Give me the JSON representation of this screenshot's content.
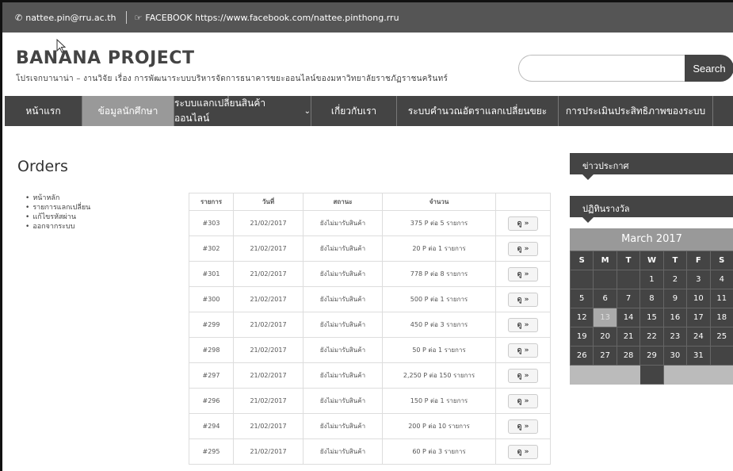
{
  "topbar": {
    "email": "nattee.pin@rru.ac.th",
    "facebook": "FACEBOOK https://www.facebook.com/nattee.pinthong.rru"
  },
  "brand": {
    "title": "BANANA PROJECT",
    "subtitle": "โปรเจกบานาน่า – งานวิจัย เรื่อง การพัฒนาระบบบริหารจัดการธนาคารขยะออนไลน์ของมหาวิทยาลัยราชภัฏราชนครินทร์"
  },
  "search": {
    "placeholder": "",
    "button": "Search"
  },
  "nav": {
    "items": [
      "หน้าแรก",
      "ข้อมูลนักศึกษา",
      "ระบบแลกเปลี่ยนสินค้าออนไลน์",
      "เกี่ยวกับเรา",
      "ระบบคำนวณอัตราแลกเปลี่ยนขยะ",
      "การประเมินประสิทธิภาพของระบบ"
    ]
  },
  "page": {
    "heading": "Orders"
  },
  "menu": [
    "หน้าหลัก",
    "รายการแลกเปลี่ยน",
    "แก้ไขรหัสผ่าน",
    "ออกจากระบบ"
  ],
  "orders": {
    "headers": [
      "รายการ",
      "วันที่",
      "สถานะ",
      "จำนวน",
      ""
    ],
    "view_label": "ดู »",
    "rows": [
      {
        "id": "#303",
        "date": "21/02/2017",
        "status": "ยังไม่มารับสินค้า",
        "amount": "375 P ต่อ 5 รายการ"
      },
      {
        "id": "#302",
        "date": "21/02/2017",
        "status": "ยังไม่มารับสินค้า",
        "amount": "20 P ต่อ 1 รายการ"
      },
      {
        "id": "#301",
        "date": "21/02/2017",
        "status": "ยังไม่มารับสินค้า",
        "amount": "778 P ต่อ 8 รายการ"
      },
      {
        "id": "#300",
        "date": "21/02/2017",
        "status": "ยังไม่มารับสินค้า",
        "amount": "500 P ต่อ 1 รายการ"
      },
      {
        "id": "#299",
        "date": "21/02/2017",
        "status": "ยังไม่มารับสินค้า",
        "amount": "450 P ต่อ 3 รายการ"
      },
      {
        "id": "#298",
        "date": "21/02/2017",
        "status": "ยังไม่มารับสินค้า",
        "amount": "50 P ต่อ 1 รายการ"
      },
      {
        "id": "#297",
        "date": "21/02/2017",
        "status": "ยังไม่มารับสินค้า",
        "amount": "2,250 P ต่อ 150 รายการ"
      },
      {
        "id": "#296",
        "date": "21/02/2017",
        "status": "ยังไม่มารับสินค้า",
        "amount": "150 P ต่อ 1 รายการ"
      },
      {
        "id": "#294",
        "date": "21/02/2017",
        "status": "ยังไม่มารับสินค้า",
        "amount": "200 P ต่อ 10 รายการ"
      },
      {
        "id": "#295",
        "date": "21/02/2017",
        "status": "ยังไม่มารับสินค้า",
        "amount": "60 P ต่อ 3 รายการ"
      }
    ]
  },
  "sidebar": {
    "news": "ข่าวประกาศ",
    "calendar_title": "ปฏิทินรางวัล"
  },
  "calendar": {
    "month": "March 2017",
    "weekdays": [
      "S",
      "M",
      "T",
      "W",
      "T",
      "F",
      "S"
    ],
    "weeks": [
      [
        "",
        "",
        "",
        "1",
        "2",
        "3",
        "4"
      ],
      [
        "5",
        "6",
        "7",
        "8",
        "9",
        "10",
        "11"
      ],
      [
        "12",
        "13",
        "14",
        "15",
        "16",
        "17",
        "18"
      ],
      [
        "19",
        "20",
        "21",
        "22",
        "23",
        "24",
        "25"
      ],
      [
        "26",
        "27",
        "28",
        "29",
        "30",
        "31",
        ""
      ]
    ],
    "today": "13"
  }
}
